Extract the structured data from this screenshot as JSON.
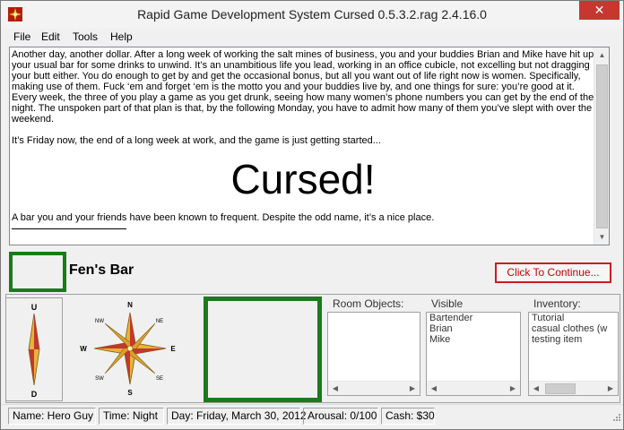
{
  "window": {
    "title": "Rapid Game Development System Cursed 0.5.3.2.rag 2.4.16.0",
    "close_glyph": "✕"
  },
  "menu": [
    "File",
    "Edit",
    "Tools",
    "Help"
  ],
  "story": {
    "paragraph1": "Another day, another dollar. After a long week of working the salt mines of business, you and your buddies Brian and Mike have hit up your usual bar for some drinks to unwind. It’s an unambitious life you lead, working in an office cubicle, not excelling but not dragging your butt either. You do enough to get by and get the occasional bonus, but all you want out of life right now is women. Specifically, making use of them. Fuck ‘em and forget ‘em is the motto you and your buddies live by, and one things for sure: you’re good at it. Every week, the three of you play a game as you get drunk, seeing how many women’s phone numbers you can get by the end of the night. The unspoken part of that plan is that, by the following Monday, you have to admit how many of them you’ve slept with over the weekend.",
    "paragraph2": "It’s Friday now, the end of a long week at work, and the game is just getting started...",
    "big_title": "Cursed!",
    "paragraph3": "A bar you and your friends have been known to frequent. Despite the odd name, it’s a nice place."
  },
  "room": {
    "name": "Fen's Bar"
  },
  "continue_button": "Click To Continue...",
  "compass": {
    "small": {
      "up": "U",
      "down": "D"
    },
    "big": {
      "n": "N",
      "ne": "NE",
      "e": "E",
      "se": "SE",
      "s": "S",
      "sw": "SW",
      "w": "W",
      "nw": "NW"
    }
  },
  "panels": {
    "room_objects": {
      "label": "Room Objects:",
      "items": []
    },
    "visible_characters": {
      "label": "Visible Characters:",
      "items": [
        "Bartender",
        "Brian",
        "Mike"
      ]
    },
    "inventory": {
      "label": "Inventory:",
      "items": [
        "Tutorial",
        "casual clothes (w",
        "testing item"
      ]
    }
  },
  "status": {
    "name": "Name: Hero Guy",
    "time": "Time: Night",
    "day": "Day: Friday, March 30, 2012",
    "arousal": "Arousal: 0/100",
    "cash": "Cash: $30"
  },
  "colors": {
    "frame_green": "#1b7a1b",
    "continue_red": "#d01a1a",
    "close_red": "#c7372f"
  }
}
